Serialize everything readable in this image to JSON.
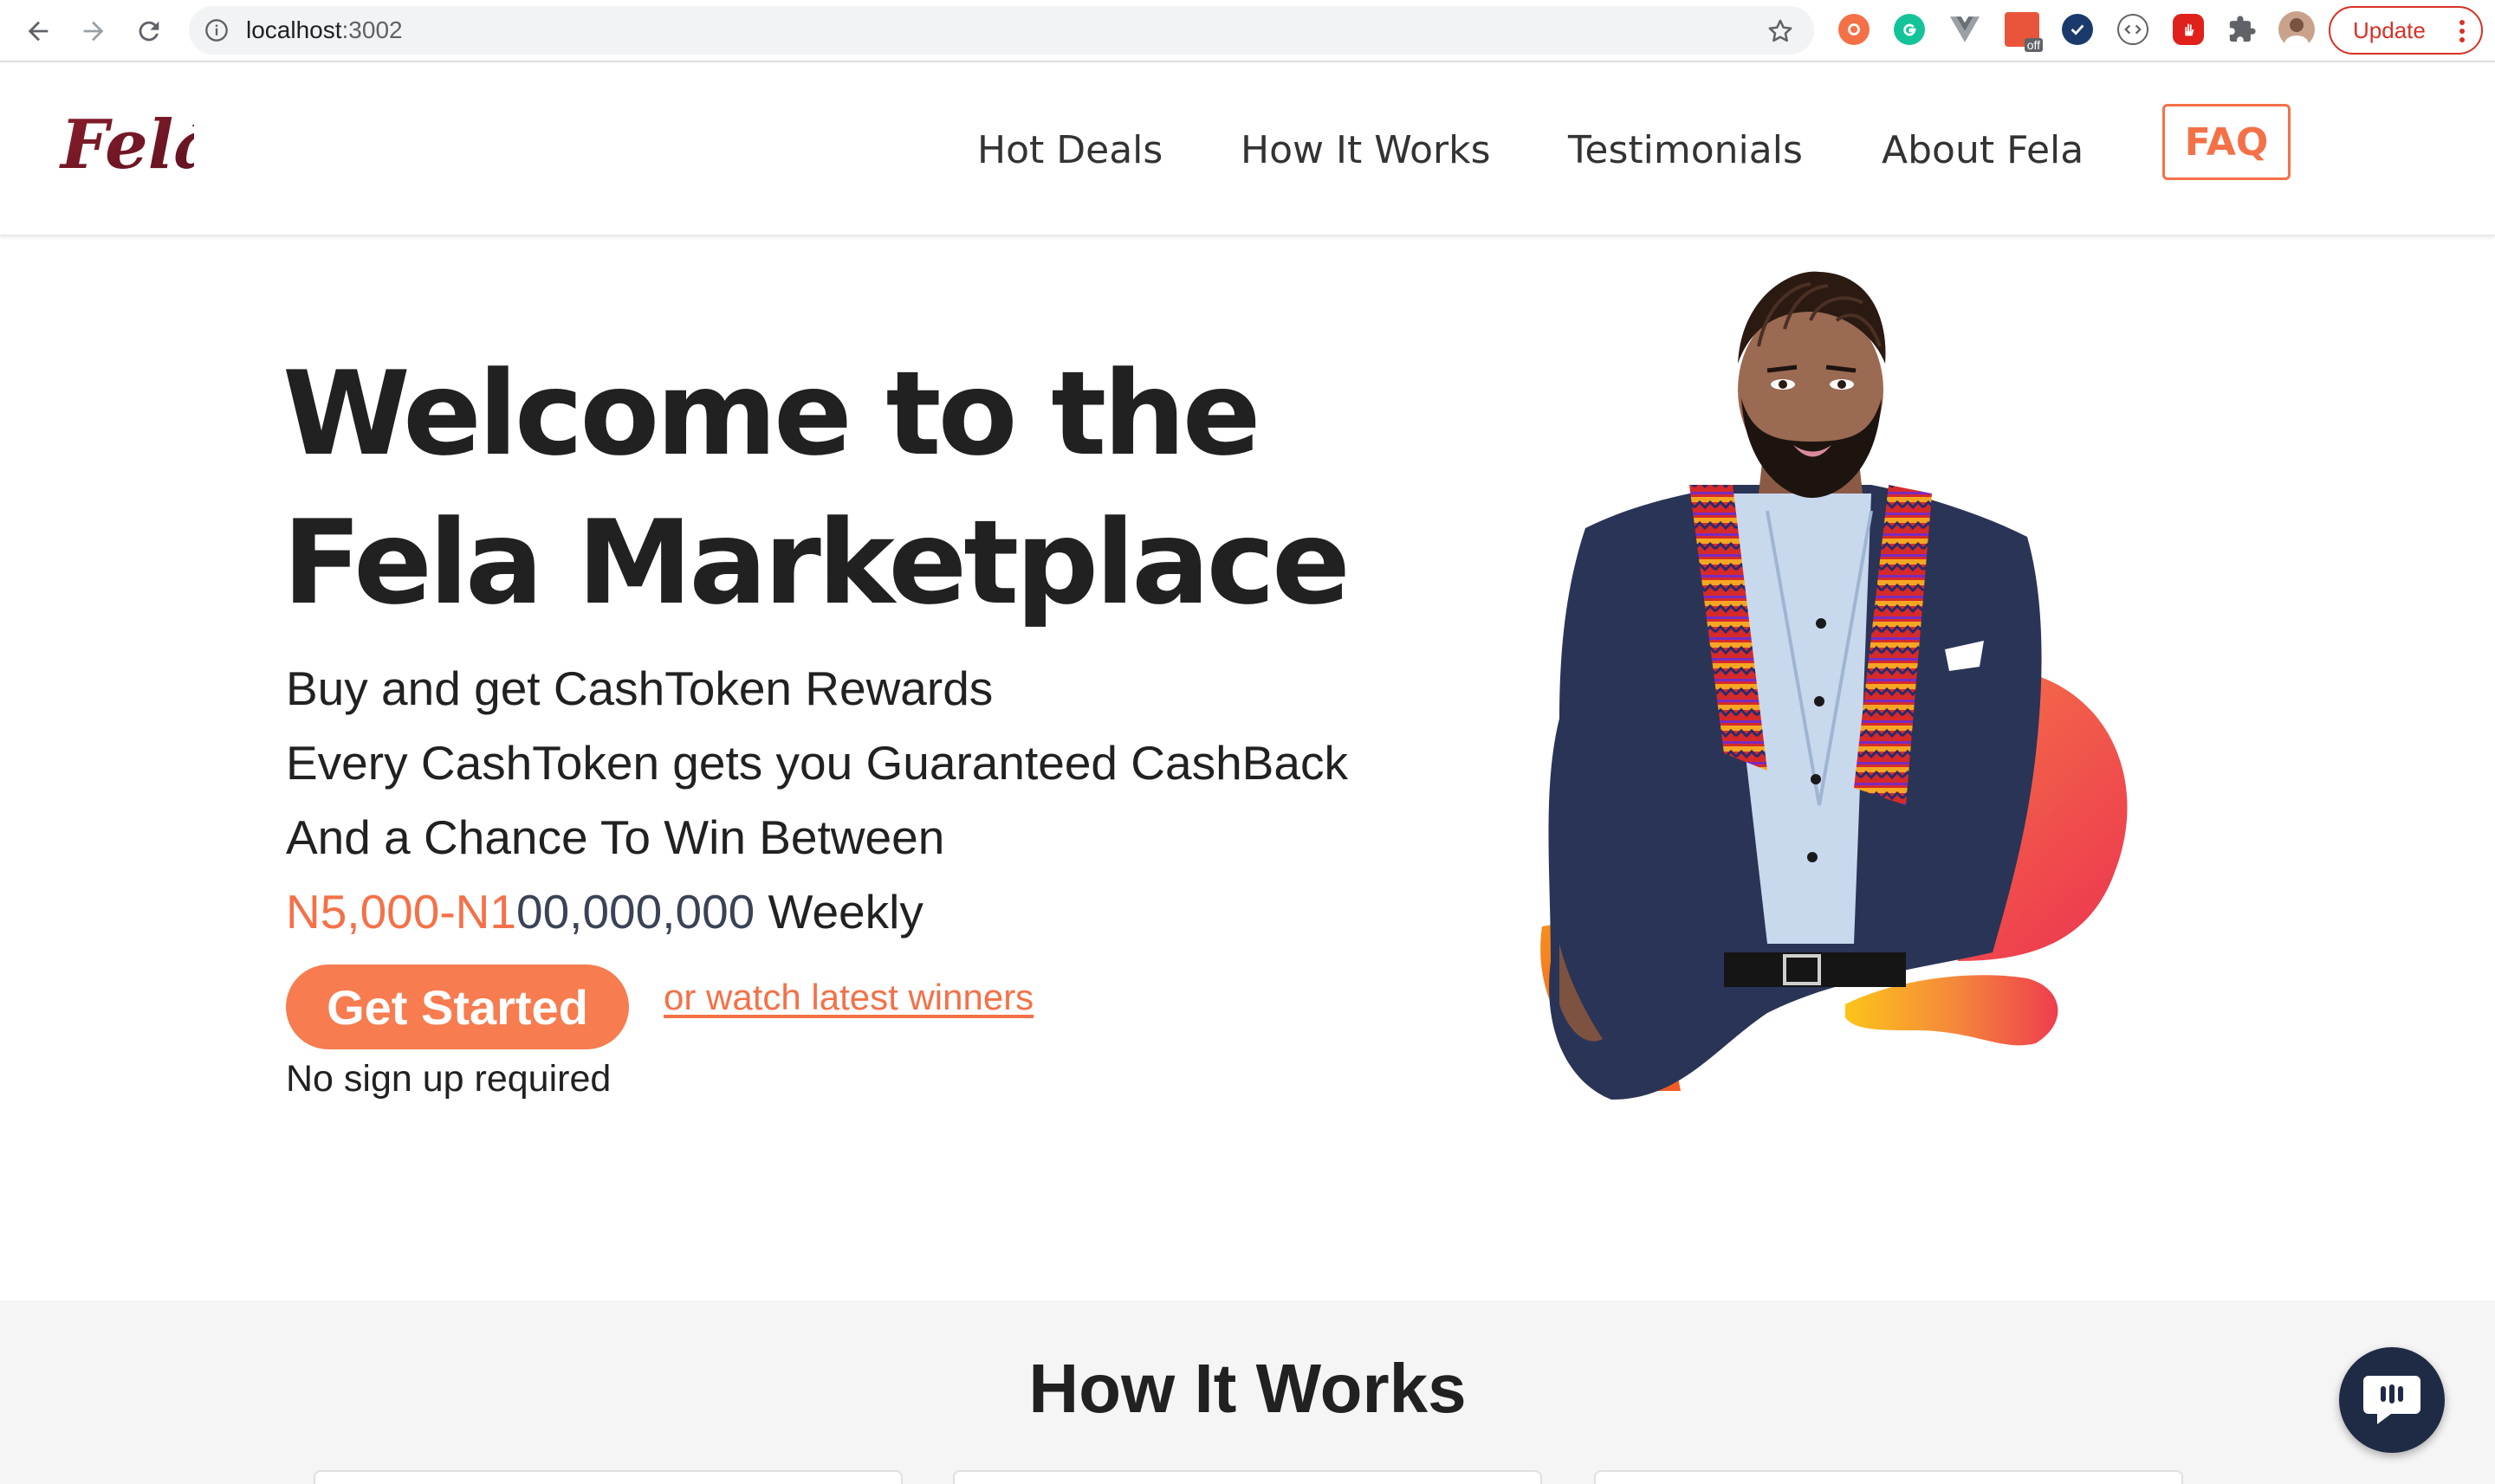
{
  "browser": {
    "url_host": "localhost",
    "url_port": ":3002",
    "update_label": "Update",
    "extension_off_badge": "off"
  },
  "header": {
    "logo_text": "Felá",
    "nav": [
      {
        "label": "Hot Deals"
      },
      {
        "label": "How It Works"
      },
      {
        "label": "Testimonials"
      },
      {
        "label": "About Fela"
      }
    ],
    "faq_label": "FAQ"
  },
  "hero": {
    "title_line1": "Welcome to the",
    "title_line2": "Fela Marketplace",
    "line1": "Buy and get CashToken Rewards",
    "line2": "Every CashToken gets you Guaranteed CashBack",
    "line3": "And a Chance To Win Between",
    "prize_orange": "N5,000-N1",
    "prize_dark": "00,000,000",
    "prize_suffix": " Weekly",
    "cta_label": "Get Started",
    "watch_link": "or watch latest winners",
    "note": "No sign up required"
  },
  "how_it_works": {
    "title": "How It Works"
  },
  "colors": {
    "accent": "#f47148",
    "button": "#f77c4f",
    "dark_navy": "#1f2b45",
    "section_bg": "#f5f5f5"
  },
  "icons": [
    "back-arrow-icon",
    "forward-arrow-icon",
    "reload-icon",
    "info-icon",
    "star-icon",
    "puzzle-icon",
    "chat-icon",
    "more-vert-icon"
  ]
}
